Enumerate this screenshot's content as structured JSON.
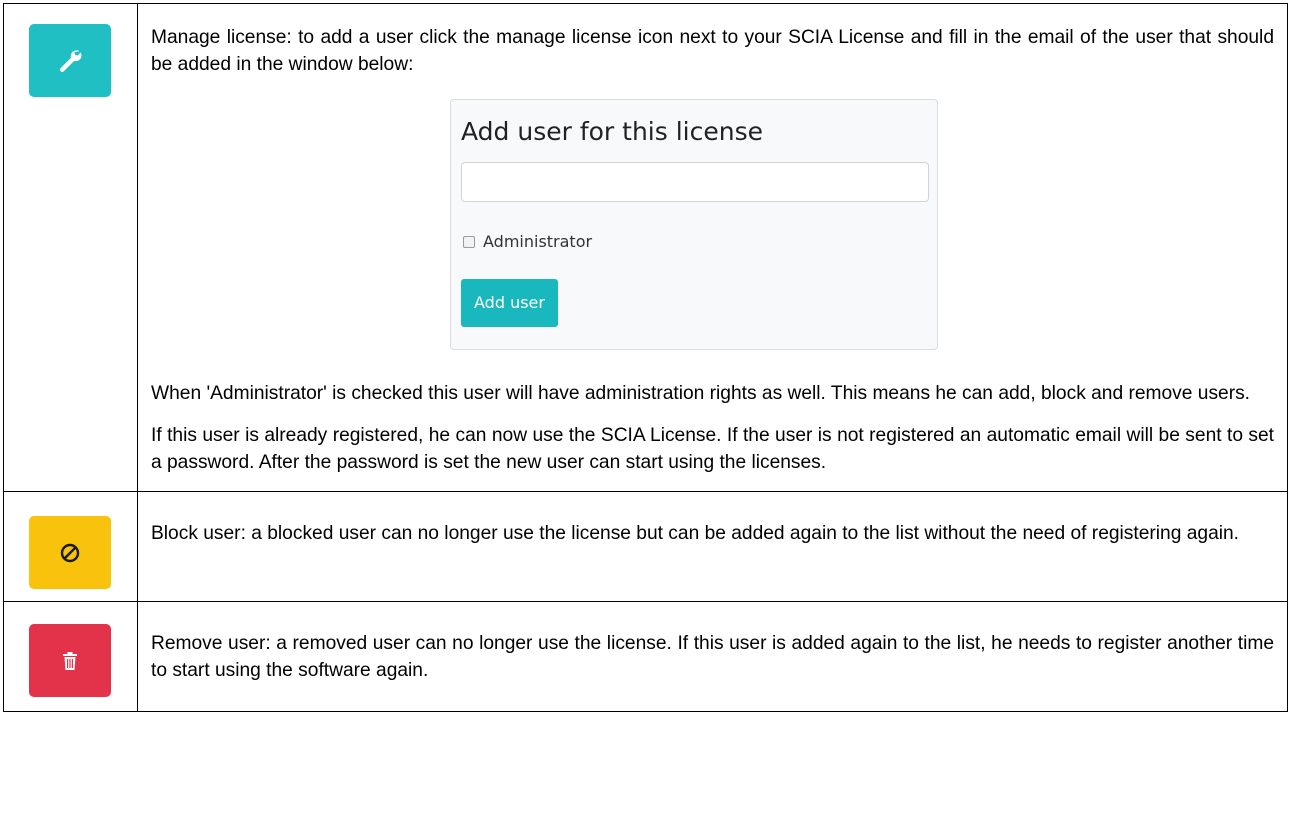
{
  "rows": [
    {
      "icon": "wrench-icon",
      "icon_color": "#1fbfc4",
      "paragraphs": [
        "Manage license: to add a user click the manage license icon next to your SCIA License and fill in the email of the user that should be added in the window below:",
        "When 'Administrator' is checked this user will have administration rights as well. This means he can add, block and remove users.",
        "If this user is already registered, he can now use the SCIA License. If the user is not registered an automatic email will be sent to set a password. After the password is set the new user can start using the licenses."
      ]
    },
    {
      "icon": "block-icon",
      "icon_color": "#f9c20c",
      "paragraphs": [
        "Block user: a blocked user can no longer use the license but can be added again to the list without the need of registering again."
      ]
    },
    {
      "icon": "trash-icon",
      "icon_color": "#e2334b",
      "paragraphs": [
        "Remove user: a removed user can no longer use the license. If this user is added again to the list, he needs to register another time to start using the software again."
      ]
    }
  ],
  "dialog": {
    "title": "Add user for this license",
    "email_value": "",
    "admin_label": "Administrator",
    "admin_checked": false,
    "add_button_label": "Add user",
    "accent": "#19b8be"
  }
}
